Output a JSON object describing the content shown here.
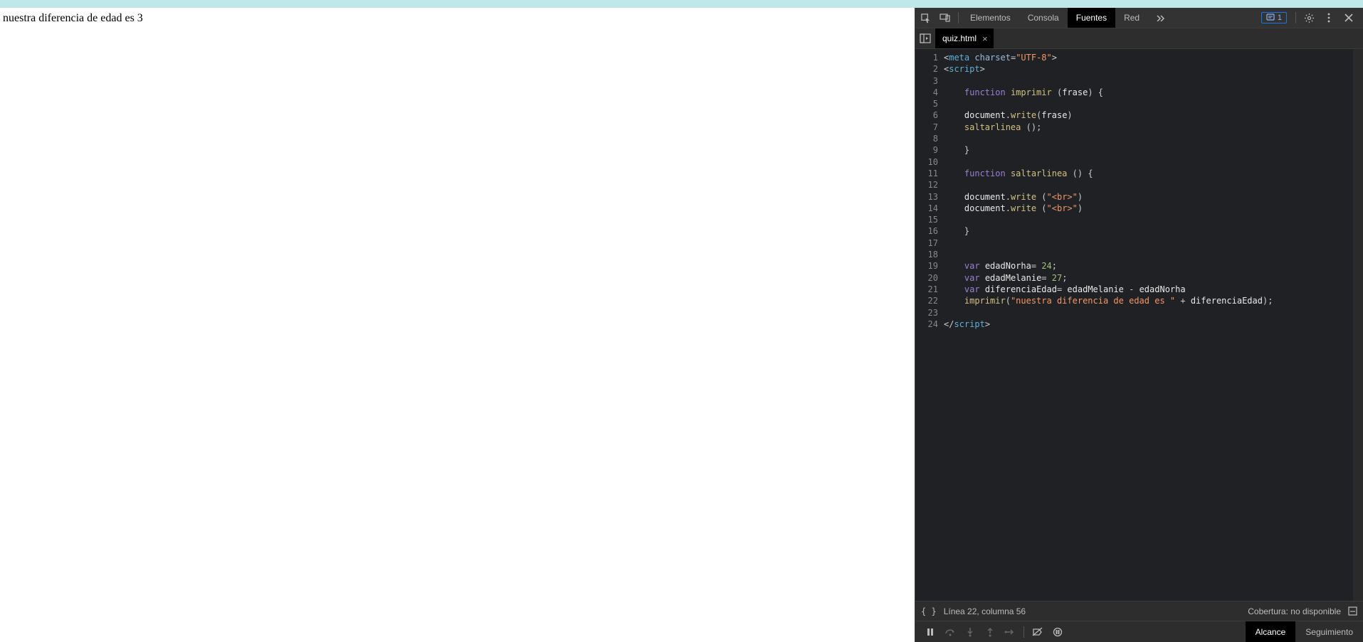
{
  "page": {
    "text": "nuestra diferencia de edad es 3"
  },
  "toolbar": {
    "tabs": {
      "elements": "Elementos",
      "console": "Consola",
      "sources": "Fuentes",
      "network": "Red"
    },
    "issues_count": "1"
  },
  "file_tab": {
    "name": "quiz.html"
  },
  "code_lines": [
    {
      "n": 1,
      "t": [
        [
          "punct",
          "<"
        ],
        [
          "tag",
          "meta"
        ],
        [
          "ident",
          " "
        ],
        [
          "attr",
          "charset"
        ],
        [
          "punct",
          "="
        ],
        [
          "val",
          "\"UTF-8\""
        ],
        [
          "punct",
          ">"
        ]
      ]
    },
    {
      "n": 2,
      "t": [
        [
          "punct",
          "<"
        ],
        [
          "tag",
          "script"
        ],
        [
          "punct",
          ">"
        ]
      ]
    },
    {
      "n": 3,
      "t": []
    },
    {
      "n": 4,
      "t": [
        [
          "ident",
          "    "
        ],
        [
          "kw",
          "function"
        ],
        [
          "ident",
          " "
        ],
        [
          "func",
          "imprimir"
        ],
        [
          "ident",
          " "
        ],
        [
          "punct",
          "("
        ],
        [
          "ident",
          "frase"
        ],
        [
          "punct",
          ")"
        ],
        [
          "ident",
          " "
        ],
        [
          "punct",
          "{"
        ]
      ]
    },
    {
      "n": 5,
      "t": []
    },
    {
      "n": 6,
      "t": [
        [
          "ident",
          "    "
        ],
        [
          "ident",
          "document"
        ],
        [
          "punct",
          "."
        ],
        [
          "func",
          "write"
        ],
        [
          "punct",
          "("
        ],
        [
          "ident",
          "frase"
        ],
        [
          "punct",
          ")"
        ]
      ]
    },
    {
      "n": 7,
      "t": [
        [
          "ident",
          "    "
        ],
        [
          "func",
          "saltarlinea"
        ],
        [
          "ident",
          " "
        ],
        [
          "punct",
          "("
        ],
        [
          "punct",
          ")"
        ],
        [
          "punct",
          ";"
        ]
      ]
    },
    {
      "n": 8,
      "t": []
    },
    {
      "n": 9,
      "t": [
        [
          "ident",
          "    "
        ],
        [
          "punct",
          "}"
        ]
      ]
    },
    {
      "n": 10,
      "t": []
    },
    {
      "n": 11,
      "t": [
        [
          "ident",
          "    "
        ],
        [
          "kw",
          "function"
        ],
        [
          "ident",
          " "
        ],
        [
          "func",
          "saltarlinea"
        ],
        [
          "ident",
          " "
        ],
        [
          "punct",
          "("
        ],
        [
          "punct",
          ")"
        ],
        [
          "ident",
          " "
        ],
        [
          "punct",
          "{"
        ]
      ]
    },
    {
      "n": 12,
      "t": []
    },
    {
      "n": 13,
      "t": [
        [
          "ident",
          "    "
        ],
        [
          "ident",
          "document"
        ],
        [
          "punct",
          "."
        ],
        [
          "func",
          "write"
        ],
        [
          "ident",
          " "
        ],
        [
          "punct",
          "("
        ],
        [
          "str",
          "\"<br>\""
        ],
        [
          "punct",
          ")"
        ]
      ]
    },
    {
      "n": 14,
      "t": [
        [
          "ident",
          "    "
        ],
        [
          "ident",
          "document"
        ],
        [
          "punct",
          "."
        ],
        [
          "func",
          "write"
        ],
        [
          "ident",
          " "
        ],
        [
          "punct",
          "("
        ],
        [
          "str",
          "\"<br>\""
        ],
        [
          "punct",
          ")"
        ]
      ]
    },
    {
      "n": 15,
      "t": []
    },
    {
      "n": 16,
      "t": [
        [
          "ident",
          "    "
        ],
        [
          "punct",
          "}"
        ]
      ]
    },
    {
      "n": 17,
      "t": []
    },
    {
      "n": 18,
      "t": []
    },
    {
      "n": 19,
      "t": [
        [
          "ident",
          "    "
        ],
        [
          "kw",
          "var"
        ],
        [
          "ident",
          " edadNorha"
        ],
        [
          "op",
          "="
        ],
        [
          "ident",
          " "
        ],
        [
          "num",
          "24"
        ],
        [
          "punct",
          ";"
        ]
      ]
    },
    {
      "n": 20,
      "t": [
        [
          "ident",
          "    "
        ],
        [
          "kw",
          "var"
        ],
        [
          "ident",
          " edadMelanie"
        ],
        [
          "op",
          "="
        ],
        [
          "ident",
          " "
        ],
        [
          "num",
          "27"
        ],
        [
          "punct",
          ";"
        ]
      ]
    },
    {
      "n": 21,
      "t": [
        [
          "ident",
          "    "
        ],
        [
          "kw",
          "var"
        ],
        [
          "ident",
          " diferenciaEdad"
        ],
        [
          "op",
          "="
        ],
        [
          "ident",
          " edadMelanie "
        ],
        [
          "op",
          "-"
        ],
        [
          "ident",
          " edadNorha"
        ]
      ]
    },
    {
      "n": 22,
      "t": [
        [
          "ident",
          "    "
        ],
        [
          "func",
          "imprimir"
        ],
        [
          "punct",
          "("
        ],
        [
          "str",
          "\"nuestra diferencia de edad es \""
        ],
        [
          "ident",
          " "
        ],
        [
          "op",
          "+"
        ],
        [
          "ident",
          " diferenciaEdad"
        ],
        [
          "punct",
          ")"
        ],
        [
          "punct",
          ";"
        ]
      ]
    },
    {
      "n": 23,
      "t": []
    },
    {
      "n": 24,
      "t": [
        [
          "punct",
          "</"
        ],
        [
          "tag",
          "script"
        ],
        [
          "punct",
          ">"
        ]
      ]
    }
  ],
  "status": {
    "cursor": "Línea 22, columna 56",
    "coverage": "Cobertura: no disponible"
  },
  "debug_tabs": {
    "scope": "Alcance",
    "watch": "Seguimiento"
  }
}
